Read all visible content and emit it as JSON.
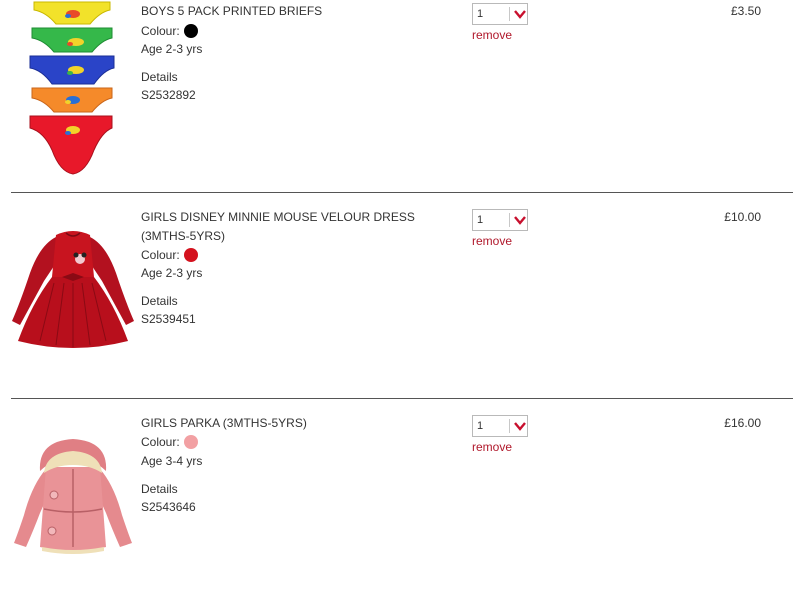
{
  "basket": {
    "items": [
      {
        "name": "BOYS 5 PACK PRINTED BRIEFS",
        "colour_label": "Colour:",
        "colour": "#000000",
        "age": "Age 2-3 yrs",
        "details_label": "Details",
        "sku": "S2532892",
        "qty": "1",
        "remove_label": "remove",
        "price": "£3.50",
        "image": "briefs-5-pack"
      },
      {
        "name": "GIRLS DISNEY MINNIE MOUSE VELOUR DRESS (3MTHS-5YRS)",
        "colour_label": "Colour:",
        "colour": "#d4121e",
        "age": "Age 2-3 yrs",
        "details_label": "Details",
        "sku": "S2539451",
        "qty": "1",
        "remove_label": "remove",
        "price": "£10.00",
        "image": "red-velour-dress"
      },
      {
        "name": "GIRLS PARKA (3MTHS-5YRS)",
        "colour_label": "Colour:",
        "colour": "#f2a0a3",
        "age": "Age 3-4 yrs",
        "details_label": "Details",
        "sku": "S2543646",
        "qty": "1",
        "remove_label": "remove",
        "price": "£16.00",
        "image": "pink-parka"
      }
    ]
  },
  "colors": {
    "accent": "#b0182b",
    "divider": "#555555"
  }
}
